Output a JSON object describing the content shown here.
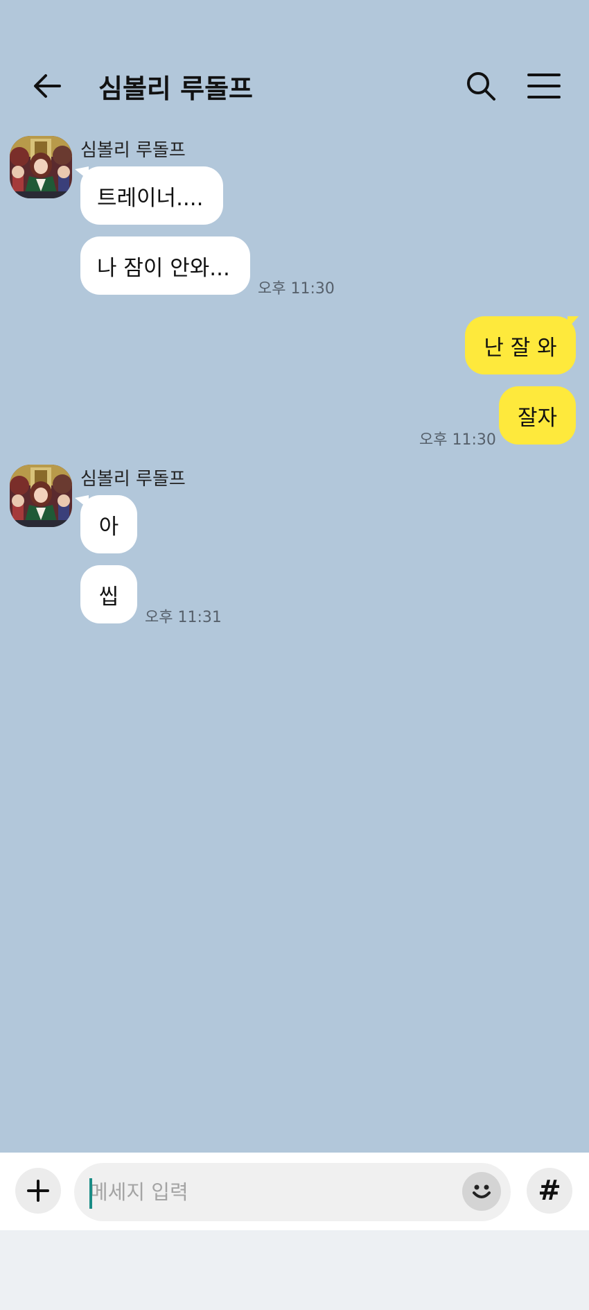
{
  "header": {
    "title": "심볼리 루돌프",
    "back_icon": "arrow-left-icon",
    "search_icon": "search-icon",
    "menu_icon": "hamburger-menu-icon"
  },
  "messages": {
    "group1": {
      "sender": "심볼리 루돌프",
      "bubble1": "트레이너....",
      "bubble2": "나 잠이 안와...",
      "time": "오후 11:30"
    },
    "group2": {
      "bubble1": "난 잘 와",
      "bubble2": "잘자",
      "time": "오후 11:30"
    },
    "group3": {
      "sender": "심볼리 루돌프",
      "bubble1": "아",
      "bubble2": "씹",
      "time": "오후 11:31"
    }
  },
  "input_bar": {
    "placeholder": "메세지 입력",
    "value": "",
    "plus_icon": "plus-icon",
    "emoji_icon": "emoji-smile-icon",
    "hash_label": "#"
  },
  "colors": {
    "chat_background": "#b2c7da",
    "incoming_bubble": "#ffffff",
    "outgoing_bubble": "#fee93c",
    "cursor": "#1a8c86"
  }
}
